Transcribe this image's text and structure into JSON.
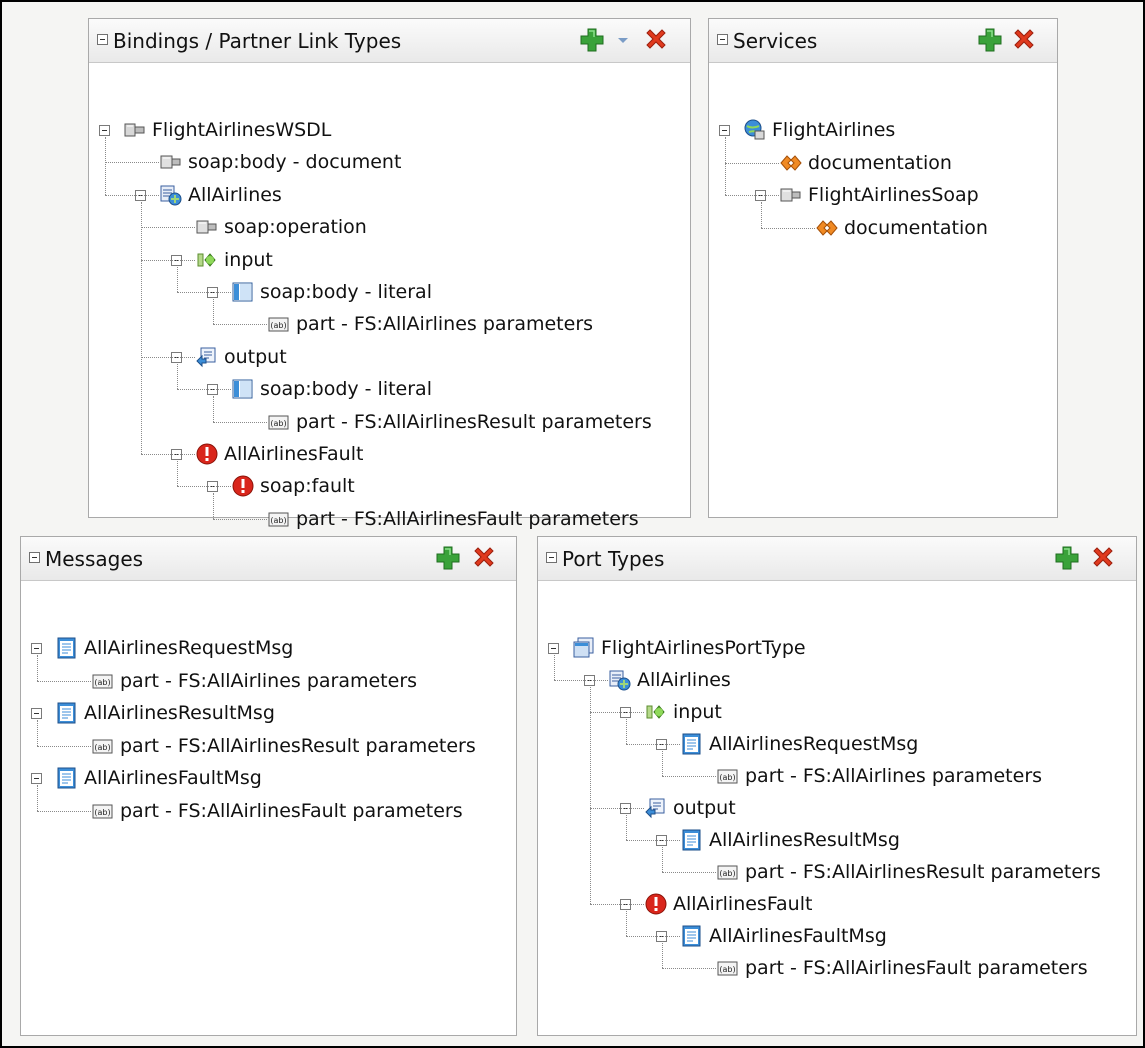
{
  "panels": {
    "bindings": {
      "title": "Bindings / Partner Link Types",
      "nodes": [
        {
          "depth": 0,
          "icon": "binding",
          "label": "FlightAirlinesWSDL",
          "expanded": true
        },
        {
          "depth": 1,
          "icon": "connector",
          "label": "soap:body - document"
        },
        {
          "depth": 1,
          "icon": "operation",
          "label": "AllAirlines",
          "expanded": true
        },
        {
          "depth": 2,
          "icon": "connector",
          "label": "soap:operation"
        },
        {
          "depth": 2,
          "icon": "input",
          "label": "input",
          "expanded": true
        },
        {
          "depth": 3,
          "icon": "soap-body",
          "label": "soap:body - literal",
          "expanded": true
        },
        {
          "depth": 4,
          "icon": "part",
          "label": "part - FS:AllAirlines parameters"
        },
        {
          "depth": 2,
          "icon": "output",
          "label": "output",
          "expanded": true
        },
        {
          "depth": 3,
          "icon": "soap-body",
          "label": "soap:body - literal",
          "expanded": true
        },
        {
          "depth": 4,
          "icon": "part",
          "label": "part - FS:AllAirlinesResult parameters"
        },
        {
          "depth": 2,
          "icon": "fault",
          "label": "AllAirlinesFault",
          "expanded": true
        },
        {
          "depth": 3,
          "icon": "fault",
          "label": "soap:fault",
          "expanded": true
        },
        {
          "depth": 4,
          "icon": "part",
          "label": "part - FS:AllAirlinesFault parameters"
        }
      ]
    },
    "services": {
      "title": "Services",
      "nodes": [
        {
          "depth": 0,
          "icon": "service",
          "label": "FlightAirlines",
          "expanded": true
        },
        {
          "depth": 1,
          "icon": "documentation",
          "label": "documentation"
        },
        {
          "depth": 1,
          "icon": "connector",
          "label": "FlightAirlinesSoap",
          "expanded": true
        },
        {
          "depth": 2,
          "icon": "documentation",
          "label": "documentation"
        }
      ]
    },
    "messages": {
      "title": "Messages",
      "nodes": [
        {
          "depth": 0,
          "icon": "message",
          "label": "AllAirlinesRequestMsg",
          "expanded": true
        },
        {
          "depth": 1,
          "icon": "part",
          "label": "part - FS:AllAirlines parameters"
        },
        {
          "depth": 0,
          "icon": "message",
          "label": "AllAirlinesResultMsg",
          "expanded": true
        },
        {
          "depth": 1,
          "icon": "part",
          "label": "part - FS:AllAirlinesResult parameters"
        },
        {
          "depth": 0,
          "icon": "message",
          "label": "AllAirlinesFaultMsg",
          "expanded": true
        },
        {
          "depth": 1,
          "icon": "part",
          "label": "part - FS:AllAirlinesFault parameters"
        }
      ]
    },
    "porttypes": {
      "title": "Port Types",
      "nodes": [
        {
          "depth": 0,
          "icon": "porttype",
          "label": "FlightAirlinesPortType",
          "expanded": true
        },
        {
          "depth": 1,
          "icon": "operation",
          "label": "AllAirlines",
          "expanded": true
        },
        {
          "depth": 2,
          "icon": "input",
          "label": "input",
          "expanded": true
        },
        {
          "depth": 3,
          "icon": "message",
          "label": "AllAirlinesRequestMsg",
          "expanded": true
        },
        {
          "depth": 4,
          "icon": "part",
          "label": "part - FS:AllAirlines parameters"
        },
        {
          "depth": 2,
          "icon": "output",
          "label": "output",
          "expanded": true
        },
        {
          "depth": 3,
          "icon": "message",
          "label": "AllAirlinesResultMsg",
          "expanded": true
        },
        {
          "depth": 4,
          "icon": "part",
          "label": "part - FS:AllAirlinesResult parameters"
        },
        {
          "depth": 2,
          "icon": "fault",
          "label": "AllAirlinesFault",
          "expanded": true
        },
        {
          "depth": 3,
          "icon": "message",
          "label": "AllAirlinesFaultMsg",
          "expanded": true
        },
        {
          "depth": 4,
          "icon": "part",
          "label": "part - FS:AllAirlinesFault parameters"
        }
      ]
    }
  },
  "colors": {
    "add": "#3aa23a",
    "delete": "#e03a1e",
    "dropdown": "#7a9cc6"
  }
}
